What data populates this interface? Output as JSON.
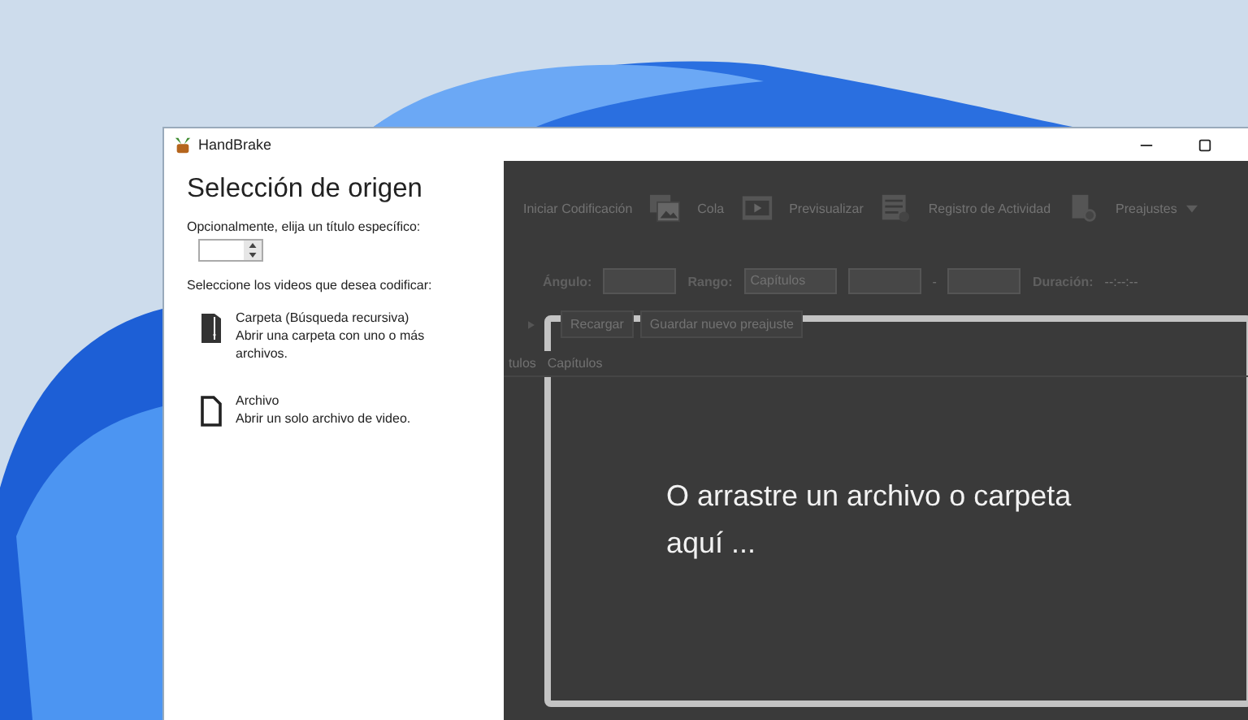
{
  "window": {
    "title": "HandBrake"
  },
  "source_panel": {
    "heading": "Selección de origen",
    "title_label": "Opcionalmente, elija un título específico:",
    "videos_label": "Seleccione los videos que desea codificar:",
    "options": [
      {
        "kind": "folder",
        "title": "Carpeta (Búsqueda recursiva)",
        "description": "Abrir una carpeta con uno o más archivos."
      },
      {
        "kind": "file",
        "title": "Archivo",
        "description": "Abrir un solo archivo de video."
      }
    ]
  },
  "toolbar": [
    {
      "kind": "none",
      "label": "Iniciar Codificación"
    },
    {
      "kind": "photos",
      "label": "Cola"
    },
    {
      "kind": "film",
      "label": "Previsualizar"
    },
    {
      "kind": "log",
      "label": "Registro de Actividad"
    },
    {
      "kind": "preset",
      "label": "Preajustes",
      "dropdown": true
    }
  ],
  "source_row": {
    "angle_label": "Ángulo:",
    "range_label": "Rango:",
    "range_value": "Capítulos",
    "range_separator": "-",
    "duration_label": "Duración:",
    "duration_value": "--:--:--"
  },
  "preset_buttons": [
    "Recargar",
    "Guardar nuevo preajuste"
  ],
  "tabs": [
    "tulos",
    "Capítulos"
  ],
  "drop_zone": {
    "text": "O arrastre un archivo o carpeta aquí ..."
  }
}
